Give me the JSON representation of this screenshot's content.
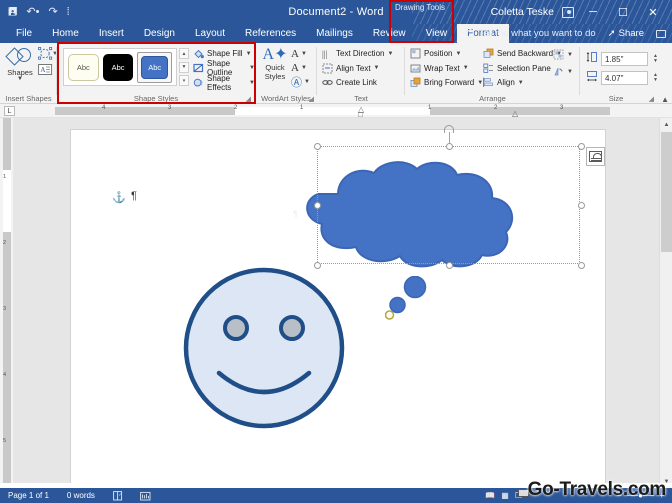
{
  "titlebar": {
    "quick_access": [
      "save-icon",
      "undo-icon",
      "redo-icon",
      "customize-icon"
    ],
    "document_title": "Document2  -  Word",
    "contextual_tab_label": "Drawing Tools",
    "user_name": "Coletta Teske",
    "account_icon": "account-icon",
    "minimize": "─",
    "maximize": "☐",
    "close": "✕"
  },
  "tabs": [
    {
      "label": "File",
      "active": false
    },
    {
      "label": "Home",
      "active": false
    },
    {
      "label": "Insert",
      "active": false
    },
    {
      "label": "Design",
      "active": false
    },
    {
      "label": "Layout",
      "active": false
    },
    {
      "label": "References",
      "active": false
    },
    {
      "label": "Mailings",
      "active": false
    },
    {
      "label": "Review",
      "active": false
    },
    {
      "label": "View",
      "active": false
    },
    {
      "label": "Format",
      "active": true
    }
  ],
  "tab_right": {
    "tell_me": "Tell me what you want to do",
    "share": "Share",
    "comments_icon": "comments-icon"
  },
  "ribbon": {
    "insert_shapes": {
      "group_label": "Insert Shapes",
      "shapes_button": "Shapes",
      "edit_shape_icon": "edit-shape-icon",
      "text_box_icon": "text-box-icon"
    },
    "shape_styles": {
      "group_label": "Shape Styles",
      "thumbnails": [
        {
          "label": "Abc",
          "style": "light"
        },
        {
          "label": "Abc",
          "style": "dark"
        },
        {
          "label": "Abc",
          "style": "blue-selected"
        }
      ],
      "commands": [
        {
          "label": "Shape Fill",
          "icon": "fill-bucket-icon",
          "has_dropdown": true
        },
        {
          "label": "Shape Outline",
          "icon": "outline-pen-icon",
          "has_dropdown": true
        },
        {
          "label": "Shape Effects",
          "icon": "effects-icon",
          "has_dropdown": true
        }
      ],
      "dialog_launcher": "dialog-launcher-icon"
    },
    "wordart_styles": {
      "group_label": "WordArt Styles",
      "quick_styles": "Quick Styles",
      "commands": [
        "text-fill-icon",
        "text-outline-icon",
        "text-effects-icon"
      ],
      "dialog_launcher": "dialog-launcher-icon"
    },
    "text": {
      "group_label": "Text",
      "commands": [
        {
          "label": "Text Direction",
          "icon": "text-direction-icon",
          "has_dropdown": true
        },
        {
          "label": "Align Text",
          "icon": "align-text-icon",
          "has_dropdown": true
        },
        {
          "label": "Create Link",
          "icon": "create-link-icon",
          "has_dropdown": false
        }
      ]
    },
    "arrange": {
      "group_label": "Arrange",
      "col1": [
        {
          "label": "Position",
          "icon": "position-icon",
          "has_dropdown": true
        },
        {
          "label": "Wrap Text",
          "icon": "wrap-text-icon",
          "has_dropdown": true
        },
        {
          "label": "Bring Forward",
          "icon": "bring-forward-icon",
          "has_dropdown": true
        }
      ],
      "col2": [
        {
          "label": "Send Backward",
          "icon": "send-backward-icon",
          "has_dropdown": true
        },
        {
          "label": "Selection Pane",
          "icon": "selection-pane-icon",
          "has_dropdown": false
        },
        {
          "label": "Align",
          "icon": "align-objects-icon",
          "has_dropdown": true
        }
      ],
      "col3": [
        {
          "icon": "group-objects-icon",
          "has_dropdown": true
        },
        {
          "icon": "rotate-objects-icon",
          "has_dropdown": true
        }
      ]
    },
    "size": {
      "group_label": "Size",
      "height_icon": "shape-height-icon",
      "height_value": "1.85\"",
      "width_icon": "shape-width-icon",
      "width_value": "4.07\"",
      "dialog_launcher": "dialog-launcher-icon",
      "collapse_ribbon": "collapse-ribbon-icon"
    }
  },
  "ruler": {
    "tab_selector": "L",
    "horizontal_numbers": [
      "4",
      "3",
      "2",
      "1",
      "1",
      "2",
      "3"
    ],
    "vertical_numbers": [
      "1",
      "2",
      "3",
      "4",
      "5"
    ]
  },
  "document": {
    "anchor_icon": "object-anchor-icon",
    "pilcrow": "¶",
    "shape_pilcrow": "¶",
    "layout_options_icon": "layout-options-icon",
    "shapes": [
      {
        "name": "thought-cloud",
        "fill": "#4472c4",
        "outline": "#2f55a0",
        "selected": true
      },
      {
        "name": "smiley-face",
        "fill": "#dce6f5",
        "outline": "#1f4e88",
        "selected": false
      },
      {
        "name": "thought-bubble-large",
        "fill": "#4472c4"
      },
      {
        "name": "thought-bubble-medium",
        "fill": "#4472c4"
      },
      {
        "name": "thought-bubble-small",
        "fill": "#ffffff",
        "outline": "#b9a63a"
      }
    ]
  },
  "statusbar": {
    "page_info": "Page 1 of 1",
    "word_count": "0 words",
    "proofing_icon": "proofing-errors-icon",
    "language_icon": "accessibility-icon",
    "view_read_icon": "read-mode-icon",
    "view_print_icon": "print-layout-icon",
    "view_web_icon": "web-layout-icon"
  },
  "watermark": {
    "text": "Go-Travels.com"
  },
  "annotations": {
    "highlight_color": "#cc0000",
    "boxes": [
      "drawing-tools-format-tab",
      "shape-styles-group"
    ]
  }
}
